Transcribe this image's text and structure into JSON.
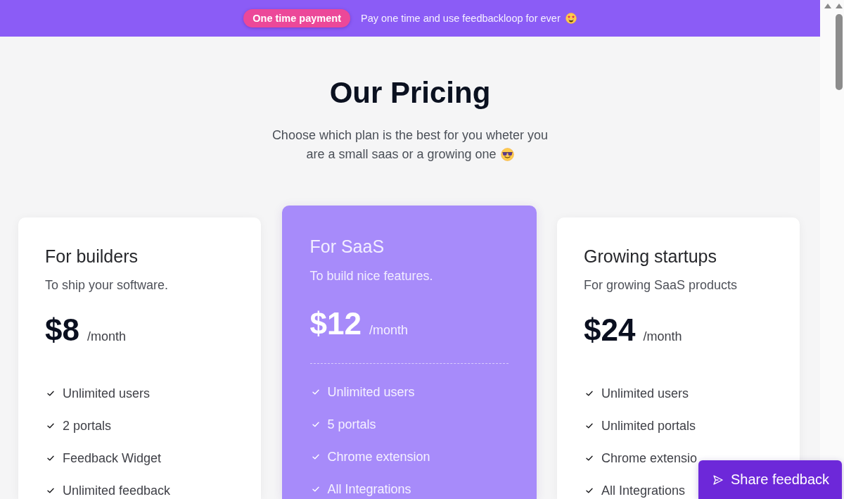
{
  "banner": {
    "badge": "One time payment",
    "text": "Pay one time and use feedbackloop for ever"
  },
  "header": {
    "title": "Our Pricing",
    "subtitle_lines": [
      "Choose which plan is the best for you wheter you",
      "are a small saas or a growing one"
    ]
  },
  "plans": [
    {
      "name": "For builders",
      "tagline": "To ship your software.",
      "price": "$8",
      "period": "/month",
      "featured": false,
      "features": [
        "Unlimited users",
        "2 portals",
        "Feedback Widget",
        "Unlimited feedback"
      ]
    },
    {
      "name": "For SaaS",
      "tagline": "To build nice features.",
      "price": "$12",
      "period": "/month",
      "featured": true,
      "features": [
        "Unlimited users",
        "5 portals",
        "Chrome extension",
        "All Integrations"
      ]
    },
    {
      "name": "Growing startups",
      "tagline": "For growing SaaS products",
      "price": "$24",
      "period": "/month",
      "featured": false,
      "features": [
        "Unlimited users",
        "Unlimited portals",
        "Chrome extensio",
        "All Integrations"
      ]
    }
  ],
  "feedback_button": {
    "label": "Share feedback"
  }
}
